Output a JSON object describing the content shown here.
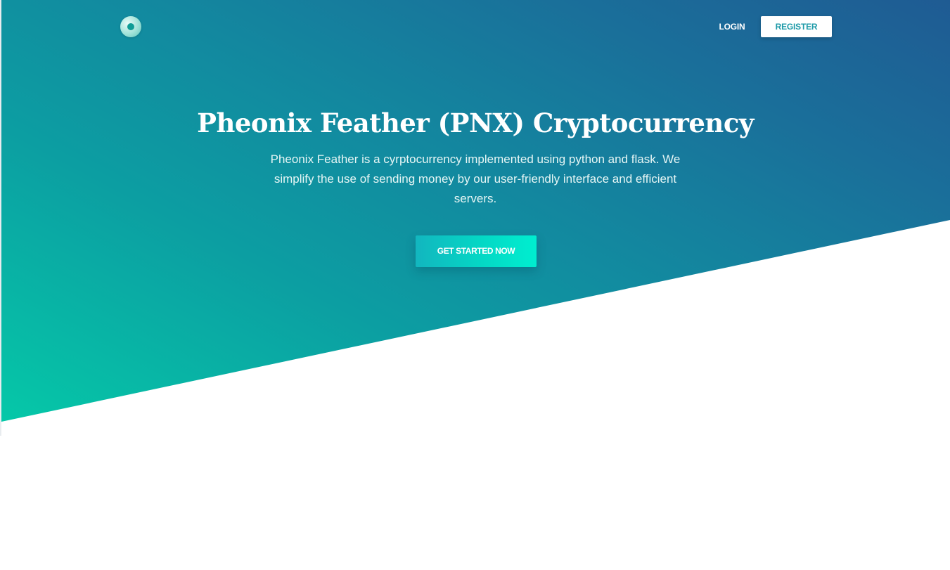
{
  "nav": {
    "logo_icon": "logo-ring-icon",
    "login_label": "LOGIN",
    "register_label": "REGISTER"
  },
  "hero": {
    "title": "Pheonix Feather (PNX) Cryptocurrency",
    "subtitle": "Pheonix Feather is a cyrptocurrency implemented using python and flask. We simplify the use of sending money by our user-friendly interface and efficient servers.",
    "cta_label": "GET STARTED NOW"
  },
  "colors": {
    "gradient_start": "#05c8a8",
    "gradient_end": "#1f5b93",
    "register_text": "#1d9aa8",
    "cta_start": "#12b6bf",
    "cta_end": "#00eed0"
  }
}
